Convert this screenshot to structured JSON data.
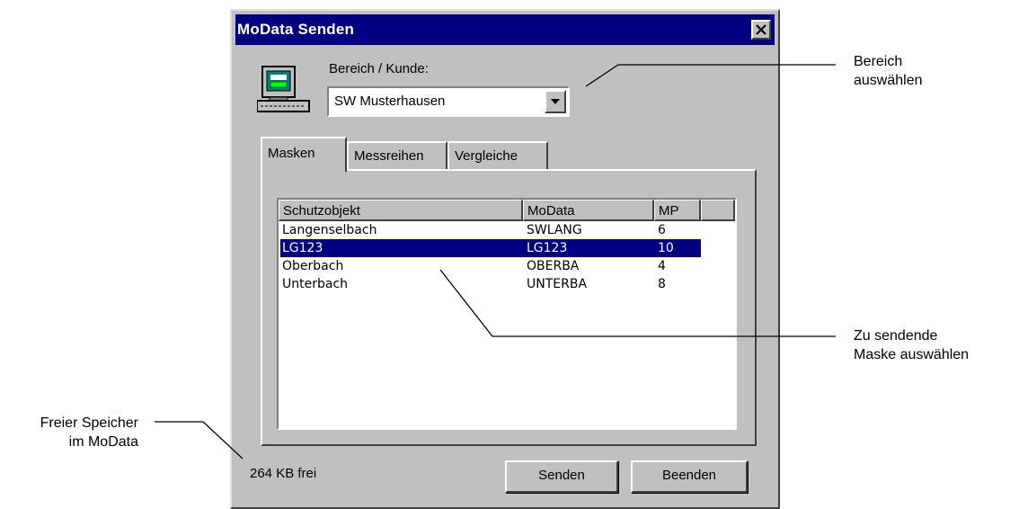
{
  "window": {
    "title": "MoData Senden",
    "close_icon": "close-icon"
  },
  "bereich": {
    "label": "Bereich / Kunde:",
    "selected": "SW Musterhausen"
  },
  "tabs": [
    {
      "label": "Masken",
      "active": true
    },
    {
      "label": "Messreihen",
      "active": false
    },
    {
      "label": "Vergleiche",
      "active": false
    }
  ],
  "list": {
    "columns": [
      "Schutzobjekt",
      "MoData",
      "MP",
      ""
    ],
    "rows": [
      {
        "schutzobjekt": "Langenselbach",
        "modata": "SWLANG",
        "mp": "6"
      },
      {
        "schutzobjekt": "LG123",
        "modata": "LG123",
        "mp": "10",
        "selected": true
      },
      {
        "schutzobjekt": "Oberbach",
        "modata": "OBERBA",
        "mp": "4"
      },
      {
        "schutzobjekt": "Unterbach",
        "modata": "UNTERBA",
        "mp": "8"
      }
    ]
  },
  "status": {
    "free": "264 KB frei"
  },
  "buttons": {
    "send": "Senden",
    "exit": "Beenden"
  },
  "annotations": {
    "bereich_line1": "Bereich",
    "bereich_line2": "auswählen",
    "maske_line1": "Zu sendende",
    "maske_line2": "Maske auswählen",
    "speicher_line1": "Freier Speicher",
    "speicher_line2": "im MoData"
  },
  "colors": {
    "titlebar": "#000080",
    "face": "#c0c0c0",
    "selection": "#000080"
  }
}
